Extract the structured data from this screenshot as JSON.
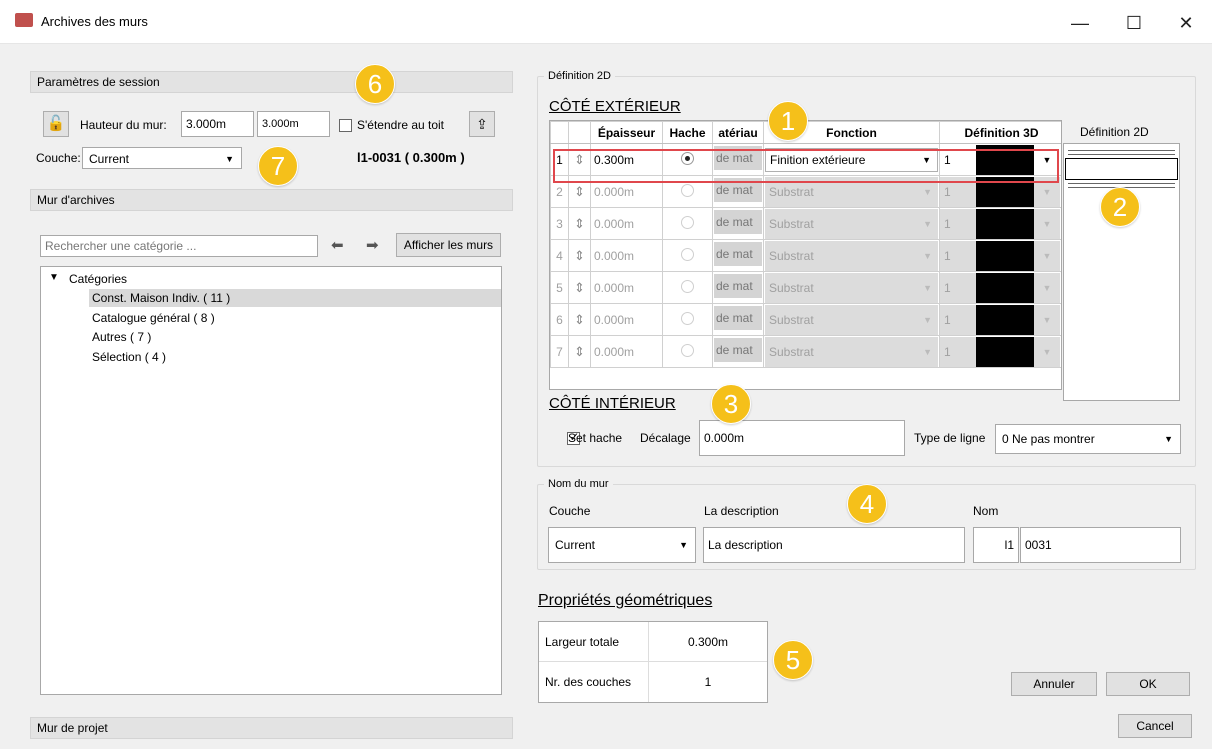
{
  "window": {
    "title": "Archives des murs",
    "minimize": "—",
    "maximize": "☐",
    "close": "✕"
  },
  "session": {
    "header": "Paramètres de session",
    "height_label": "Hauteur du mur:",
    "height1": "3.000m",
    "height2": "3.000m",
    "extend_label": "S'étendre au toit",
    "layer_label": "Couche:",
    "layer_value": "Current",
    "wall_id": "l1-0031 ( 0.300m )"
  },
  "archive": {
    "header": "Mur d'archives",
    "search_placeholder": "Rechercher une catégorie ...",
    "show_walls": "Afficher les murs",
    "tree_root": "Catégories",
    "tree_items": [
      "Const. Maison Indiv. ( 11 )",
      "Catalogue général ( 8 )",
      "Autres ( 7 )",
      "Sélection ( 4 )"
    ]
  },
  "project": {
    "header": "Mur de projet"
  },
  "def2d": {
    "group_title": "Définition 2D",
    "exterior": "CÔTÉ EXTÉRIEUR",
    "interior": "CÔTÉ INTÉRIEUR",
    "columns": [
      "Épaisseur",
      "Hache",
      "atériau",
      "Fonction",
      "Définition 3D"
    ],
    "rows": [
      {
        "n": "1",
        "thickness": "0.300m",
        "material": "de mat",
        "function": "Finition extérieure",
        "def3d": "1"
      },
      {
        "n": "2",
        "thickness": "0.000m",
        "material": "de mat",
        "function": "Substrat",
        "def3d": "1"
      },
      {
        "n": "3",
        "thickness": "0.000m",
        "material": "de mat",
        "function": "Substrat",
        "def3d": "1"
      },
      {
        "n": "4",
        "thickness": "0.000m",
        "material": "de mat",
        "function": "Substrat",
        "def3d": "1"
      },
      {
        "n": "5",
        "thickness": "0.000m",
        "material": "de mat",
        "function": "Substrat",
        "def3d": "1"
      },
      {
        "n": "6",
        "thickness": "0.000m",
        "material": "de mat",
        "function": "Substrat",
        "def3d": "1"
      },
      {
        "n": "7",
        "thickness": "0.000m",
        "material": "de mat",
        "function": "Substrat",
        "def3d": "1"
      }
    ],
    "preview_title": "Définition 2D",
    "set_hatch": "Set hache",
    "offset_label": "Décalage",
    "offset_value": "0.000m",
    "line_type_label": "Type de ligne",
    "line_type_value": "0 Ne pas montrer"
  },
  "name": {
    "group_title": "Nom du mur",
    "layer_label": "Couche",
    "layer_value": "Current",
    "desc_label": "La description",
    "desc_value": "La description",
    "name_label": "Nom",
    "name_prefix": "l1",
    "name_value": "0031"
  },
  "geometry": {
    "title": "Propriétés géométriques",
    "total_width_label": "Largeur totale",
    "total_width": "0.300m",
    "layers_label": "Nr. des couches",
    "layers": "1"
  },
  "buttons": {
    "cancel_fr": "Annuler",
    "ok": "OK",
    "cancel": "Cancel"
  },
  "badges": [
    "1",
    "2",
    "3",
    "4",
    "5",
    "6",
    "7"
  ],
  "colors": {
    "badge": "#f5c01a",
    "highlight": "#e0474c",
    "selection": "#d9d9d9"
  }
}
